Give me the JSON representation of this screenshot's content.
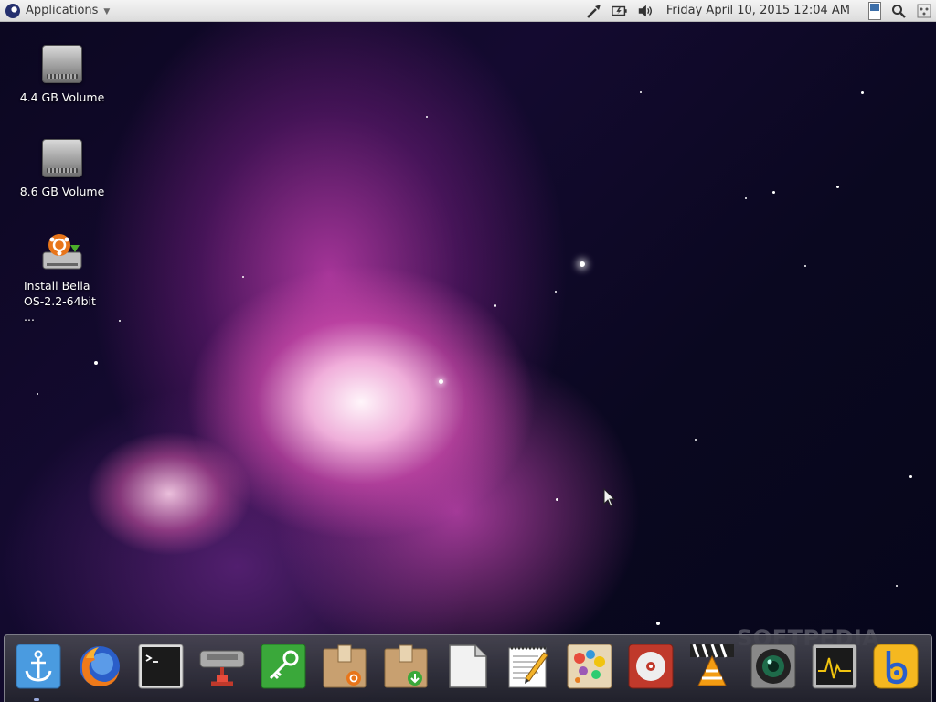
{
  "panel": {
    "applications_label": "Applications",
    "clock": "Friday April 10, 2015 12:04 AM"
  },
  "desktop": {
    "icons": [
      {
        "label": "4.4 GB Volume",
        "icon": "hard-drive-icon"
      },
      {
        "label": "8.6 GB Volume",
        "icon": "hard-drive-icon"
      },
      {
        "label": "Install Bella OS-2.2-64bit ...",
        "icon": "installer-icon"
      }
    ]
  },
  "dock": {
    "items": [
      {
        "icon": "anchor-icon"
      },
      {
        "icon": "firefox-icon"
      },
      {
        "icon": "terminal-icon"
      },
      {
        "icon": "network-tool-icon"
      },
      {
        "icon": "key-icon"
      },
      {
        "icon": "package-installer-icon"
      },
      {
        "icon": "package-download-icon"
      },
      {
        "icon": "document-icon"
      },
      {
        "icon": "text-editor-icon"
      },
      {
        "icon": "paint-icon"
      },
      {
        "icon": "media-player-icon"
      },
      {
        "icon": "vlc-icon"
      },
      {
        "icon": "camera-icon"
      },
      {
        "icon": "system-monitor-icon"
      },
      {
        "icon": "bella-b-icon"
      }
    ]
  },
  "watermark": "SOFTPEDIA",
  "colors": {
    "panel_bg": "#e6e6e6",
    "dock_bg": "#3a3a46",
    "accent_blue": "#3c6ea8"
  }
}
